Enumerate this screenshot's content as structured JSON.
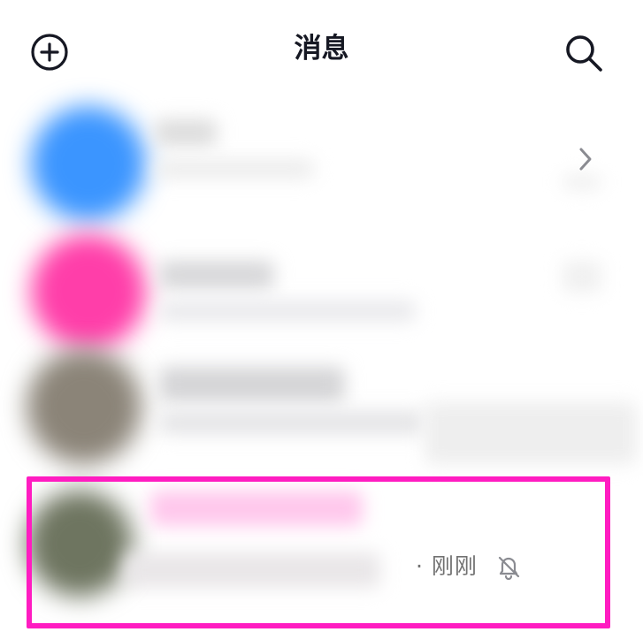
{
  "header": {
    "title": "消息",
    "add_icon": "plus-circle-icon",
    "search_icon": "search-icon"
  },
  "list": {
    "items": [
      {
        "avatar_color": "#3b95ff",
        "chevron_icon": "chevron-right-icon"
      },
      {
        "avatar_color": "#ff3ea9"
      },
      {
        "avatar_color": "#8b8478"
      },
      {
        "avatar_color": "#6e7560",
        "time": "· 刚刚",
        "muted_icon": "bell-off-icon",
        "highlight_color": "#ff1cc1"
      }
    ]
  }
}
